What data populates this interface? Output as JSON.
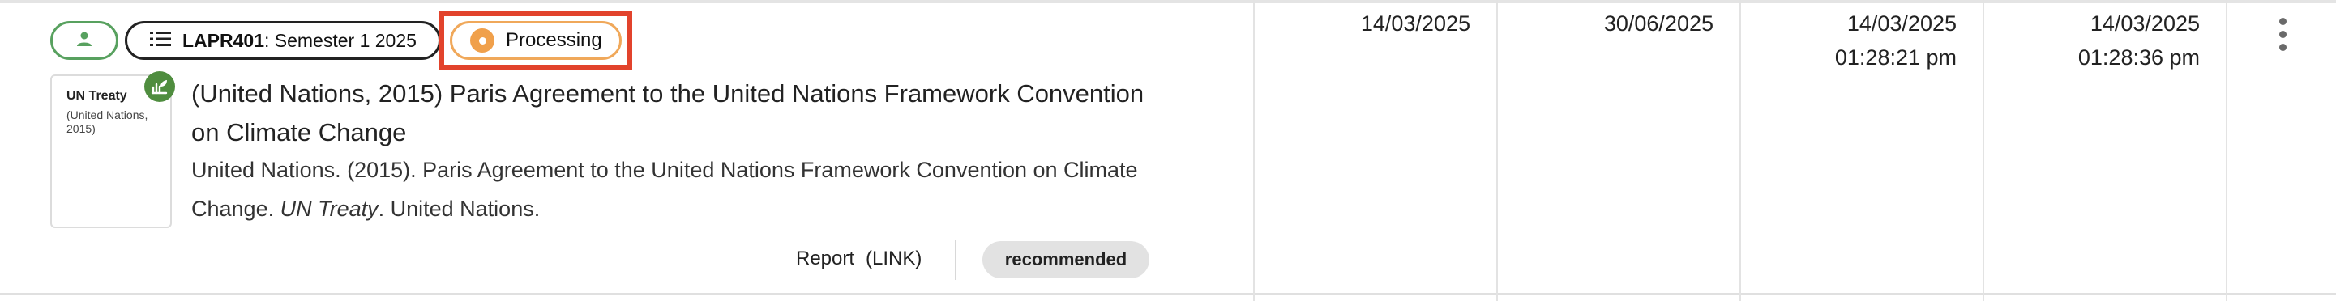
{
  "chips": {
    "user_icon": "person-icon",
    "course_icon": "list-icon",
    "course_code": "LAPR401",
    "course_rest": ": Semester 1 2025",
    "status": "Processing",
    "status_color": "#f0a04b",
    "highlight_color": "#e2432c"
  },
  "thumbnail": {
    "title": "UN Treaty",
    "subtitle": "(United Nations, 2015)",
    "badge_icon": "leaf-hand-icon"
  },
  "item": {
    "title": "(United Nations, 2015) Paris Agreement to the United Nations Framework Convention on Climate Change",
    "citation_pre": "United Nations. (2015). Paris Agreement to the United Nations Framework Convention on Climate Change. ",
    "citation_source": "UN Treaty",
    "citation_post": ". United Nations."
  },
  "actions": {
    "report_label": "Report",
    "report_link": "(LINK)",
    "tag": "recommended"
  },
  "columns": {
    "col1": "14/03/2025",
    "col2": "30/06/2025",
    "col3_date": "14/03/2025",
    "col3_time": "01:28:21 pm",
    "col4_date": "14/03/2025",
    "col4_time": "01:28:36 pm"
  },
  "menu_icon": "more-vertical-icon"
}
